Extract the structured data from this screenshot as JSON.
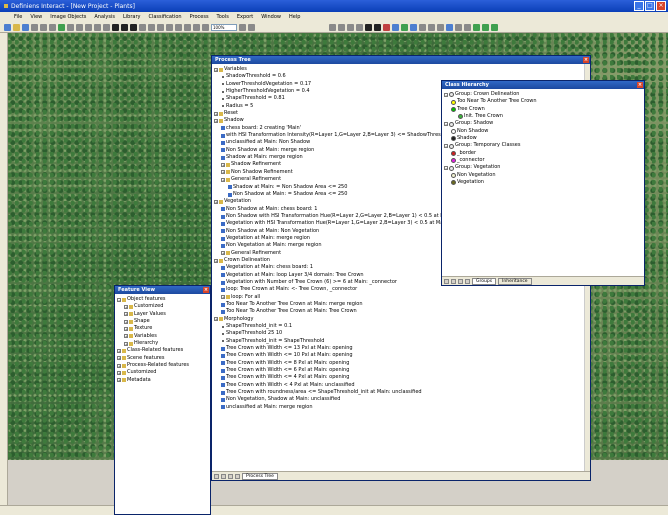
{
  "window": {
    "title": "Definiens Interact - [New Project - Plants]",
    "min": "_",
    "max": "□",
    "close": "×"
  },
  "menu": [
    "File",
    "View",
    "Image Objects",
    "Analysis",
    "Library",
    "Classification",
    "Process",
    "Tools",
    "Export",
    "Window",
    "Help"
  ],
  "toolbar": {
    "zoom": "100%"
  },
  "process_tree": {
    "title": "Process Tree",
    "tab": "Process Tree",
    "rows": [
      {
        "lvl": 0,
        "t": "node",
        "text": "Variables"
      },
      {
        "lvl": 1,
        "t": "leaf",
        "text": "ShadowThreshold = 0.6"
      },
      {
        "lvl": 1,
        "t": "leaf",
        "text": "LowerThresholdVegetation = 0.17"
      },
      {
        "lvl": 1,
        "t": "leaf",
        "text": "HigherThresholdVegetation = 0.4"
      },
      {
        "lvl": 1,
        "t": "leaf",
        "text": "ShapeThreshold = 0.81"
      },
      {
        "lvl": 1,
        "t": "leaf",
        "text": "Radius = 5"
      },
      {
        "lvl": 0,
        "t": "node",
        "text": "Reset"
      },
      {
        "lvl": 0,
        "t": "node",
        "text": "Shadow"
      },
      {
        "lvl": 1,
        "t": "proc",
        "text": "chess board: 2 creating 'Main'"
      },
      {
        "lvl": 1,
        "t": "proc",
        "text": "with HSI Transformation Intensity(R=Layer 1,G=Layer 2,B=Layer 3) <= ShadowThreshold at Main: Shadow"
      },
      {
        "lvl": 1,
        "t": "proc",
        "text": "unclassified at Main: Non Shadow"
      },
      {
        "lvl": 1,
        "t": "proc",
        "text": "Non Shadow at Main: merge region"
      },
      {
        "lvl": 1,
        "t": "proc",
        "text": "Shadow at Main: merge region"
      },
      {
        "lvl": 1,
        "t": "node",
        "text": "Shadow Refinement"
      },
      {
        "lvl": 1,
        "t": "node",
        "text": "Non Shadow Refinement"
      },
      {
        "lvl": 1,
        "t": "node",
        "text": "General Refinement"
      },
      {
        "lvl": 2,
        "t": "proc",
        "text": "Shadow at Main: = Non Shadow Area <= 250"
      },
      {
        "lvl": 2,
        "t": "proc",
        "text": "Non Shadow at Main: = Shadow Area <= 250"
      },
      {
        "lvl": 0,
        "t": "node",
        "text": "Vegetation"
      },
      {
        "lvl": 1,
        "t": "proc",
        "text": "Non Shadow at Main: chess board: 1"
      },
      {
        "lvl": 1,
        "t": "proc",
        "text": "Non Shadow with HSI Transformation Hue(R=Layer 2,G=Layer 2,B=Layer 1) < 0.5 at Main: Vegetation"
      },
      {
        "lvl": 1,
        "t": "proc",
        "text": "Vegetation with HSI Transformation Hue(R=Layer 1,G=Layer 2,B=Layer 3) < 0.5 at Main: Non Vegetation"
      },
      {
        "lvl": 1,
        "t": "proc",
        "text": "Non Shadow at Main: Non Vegetation"
      },
      {
        "lvl": 1,
        "t": "proc",
        "text": "Vegetation at Main: merge region"
      },
      {
        "lvl": 1,
        "t": "proc",
        "text": "Non Vegetation at Main: merge region"
      },
      {
        "lvl": 1,
        "t": "node",
        "text": "General Refinement"
      },
      {
        "lvl": 0,
        "t": "node",
        "text": "Crown Delineation"
      },
      {
        "lvl": 1,
        "t": "proc",
        "text": "Vegetation at Main: chess board: 1"
      },
      {
        "lvl": 1,
        "t": "proc",
        "text": "Vegetation at Main: loop Layer 3/4 domain: Tree Crown"
      },
      {
        "lvl": 1,
        "t": "proc",
        "text": "Vegetation with Number of Tree Crown (6) >= 6 at Main: _connector"
      },
      {
        "lvl": 1,
        "t": "proc",
        "text": "loop: Tree Crown at Main: <- Tree Crown, _connector"
      },
      {
        "lvl": 1,
        "t": "node",
        "text": "loop: For all"
      },
      {
        "lvl": 1,
        "t": "proc",
        "text": "Too Near To Another Tree Crown at Main: merge region"
      },
      {
        "lvl": 1,
        "t": "proc",
        "text": "Too Near To Another Tree Crown at Main: Tree Crown"
      },
      {
        "lvl": 0,
        "t": "node",
        "text": "Morphology"
      },
      {
        "lvl": 1,
        "t": "leaf",
        "text": "ShapeThreshold_init = 0.1"
      },
      {
        "lvl": 1,
        "t": "leaf",
        "text": "ShapeThreshold 25 10"
      },
      {
        "lvl": 1,
        "t": "leaf",
        "text": "ShapeThreshold_init = ShapeThreshold"
      },
      {
        "lvl": 1,
        "t": "proc",
        "text": "Tree Crown with Width <= 13 Pxl at Main: opening"
      },
      {
        "lvl": 1,
        "t": "proc",
        "text": "Tree Crown with Width <= 10 Pxl at Main: opening"
      },
      {
        "lvl": 1,
        "t": "proc",
        "text": "Tree Crown with Width <= 8 Pxl at Main: opening"
      },
      {
        "lvl": 1,
        "t": "proc",
        "text": "Tree Crown with Width <= 6 Pxl at Main: opening"
      },
      {
        "lvl": 1,
        "t": "proc",
        "text": "Tree Crown with Width <= 4 Pxl at Main: opening"
      },
      {
        "lvl": 1,
        "t": "proc",
        "text": "Tree Crown with Width < 4 Pxl at Main: unclassified"
      },
      {
        "lvl": 1,
        "t": "proc",
        "text": "Tree Crown with roundness/area <= ShapeThreshold_init at Main: unclassified"
      },
      {
        "lvl": 1,
        "t": "proc",
        "text": "Non Vegetation, Shadow at Main: unclassified"
      },
      {
        "lvl": 1,
        "t": "proc",
        "text": "unclassified at Main: merge region"
      }
    ]
  },
  "class_hierarchy": {
    "title": "Class Hierarchy",
    "tabs": [
      "Groups",
      "Inheritance"
    ],
    "rows": [
      {
        "lvl": 0,
        "text": "Group: Crown Delineation",
        "color": "#e8e8e8"
      },
      {
        "lvl": 1,
        "text": "Too Near To Another Tree Crown",
        "color": "#ffff00"
      },
      {
        "lvl": 1,
        "text": "Tree Crown",
        "color": "#00c000"
      },
      {
        "lvl": 2,
        "text": "Init. Tree Crown",
        "color": "#3cb43c"
      },
      {
        "lvl": 0,
        "text": "Group: Shadow",
        "color": "#e8e8e8"
      },
      {
        "lvl": 1,
        "text": "Non Shadow",
        "color": "#ffffff"
      },
      {
        "lvl": 1,
        "text": "Shadow",
        "color": "#202020"
      },
      {
        "lvl": 0,
        "text": "Group: Temporary Classes",
        "color": "#e8e8e8"
      },
      {
        "lvl": 1,
        "text": "_border",
        "color": "#d02020"
      },
      {
        "lvl": 1,
        "text": "_connector",
        "color": "#e020e0"
      },
      {
        "lvl": 0,
        "text": "Group: Vegetation",
        "color": "#e8e8e8"
      },
      {
        "lvl": 1,
        "text": "Non Vegetation",
        "color": "#f0f0d0"
      },
      {
        "lvl": 1,
        "text": "Vegetation",
        "color": "#6a6a20"
      }
    ]
  },
  "feature_view": {
    "title": "Feature View",
    "rows": [
      {
        "lvl": 0,
        "text": "Object features"
      },
      {
        "lvl": 1,
        "text": "Customized"
      },
      {
        "lvl": 1,
        "text": "Layer Values"
      },
      {
        "lvl": 1,
        "text": "Shape"
      },
      {
        "lvl": 1,
        "text": "Texture"
      },
      {
        "lvl": 1,
        "text": "Variables"
      },
      {
        "lvl": 1,
        "text": "Hierarchy"
      },
      {
        "lvl": 0,
        "text": "Class-Related features"
      },
      {
        "lvl": 0,
        "text": "Scene features"
      },
      {
        "lvl": 0,
        "text": "Process-Related features"
      },
      {
        "lvl": 0,
        "text": "Customized"
      },
      {
        "lvl": 0,
        "text": "Metadata"
      }
    ]
  }
}
